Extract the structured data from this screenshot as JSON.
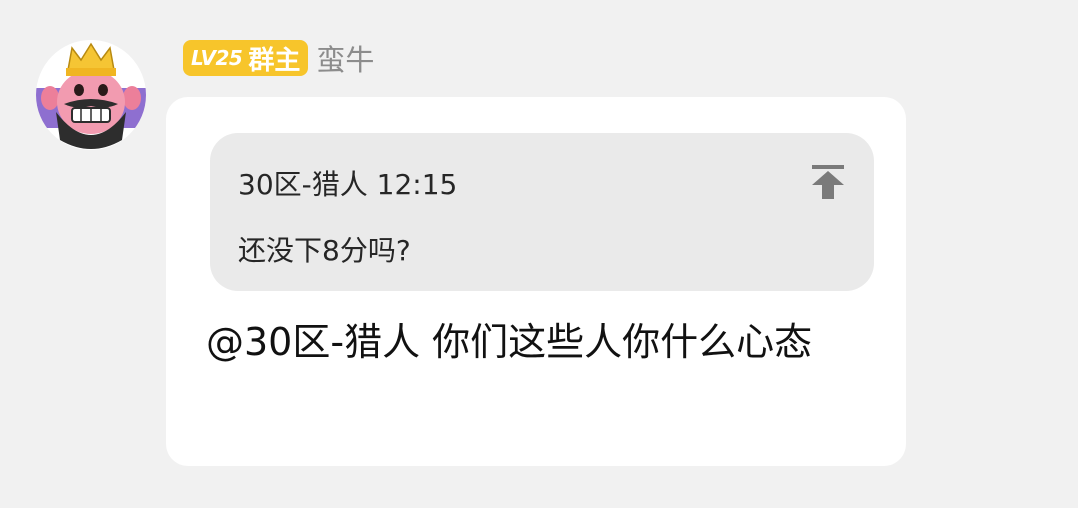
{
  "sender": {
    "level_badge": "LV25",
    "role_badge": "群主",
    "name": "蛮牛",
    "avatar_icon": "king-emote-avatar-icon",
    "badge_color": "#f7c52b"
  },
  "quote": {
    "author_time": "30区-猎人 12:15",
    "text": "还没下8分吗?",
    "jump_icon": "jump-to-top-icon"
  },
  "message": {
    "text": "@30区-猎人 你们这些人你什么心态"
  }
}
